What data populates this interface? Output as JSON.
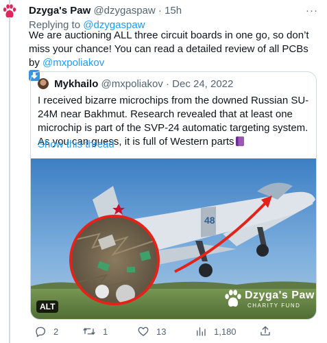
{
  "tweet": {
    "author_name": "Dzyga's Paw",
    "author_handle": "@dzygaspaw",
    "separator": "·",
    "time": "15h",
    "more_label": "···",
    "replying_prefix": "Replying to",
    "replying_to": "@dzygaspaw",
    "text_part1": "We are auctioning ALL three circuit boards in one go, so don’t miss your chance! You can read a detailed review of all PCBs by",
    "text_mention": "@mxpoliakov",
    "arrow_icon": "down-arrow-emoji"
  },
  "quote": {
    "author_name": "Mykhailo",
    "author_handle": "@mxpoliakov",
    "separator": "·",
    "date": "Dec 24, 2022",
    "text": "I received bizarre microchips from the downed Russian SU-24M near Bakhmut. Research revealed that at least one microchip is part of the SVP-24 automatic targeting system. As you can guess, it is full of Western parts",
    "emoji_icon": "purple-book-emoji",
    "show_thread": "Show this thread",
    "media_alt_badge": "ALT",
    "media_brand_name": "Dzyga's Paw",
    "media_brand_sub": "CHARITY FUND"
  },
  "actions": {
    "replies": "2",
    "retweets": "1",
    "likes": "13",
    "views": "1,180"
  },
  "colors": {
    "accent": "#1d9bf0",
    "secondary_text": "#536471",
    "paw_red": "#e0245e"
  }
}
